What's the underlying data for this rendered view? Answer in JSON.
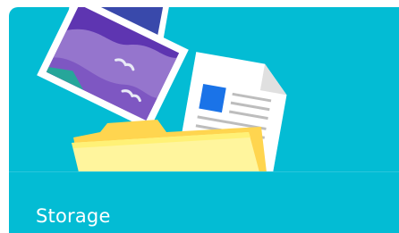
{
  "card": {
    "title": "Storage",
    "accent_color": "#03bcd4"
  },
  "illustration": {
    "items": [
      "photo-icon",
      "document-icon",
      "folder-icon"
    ]
  }
}
